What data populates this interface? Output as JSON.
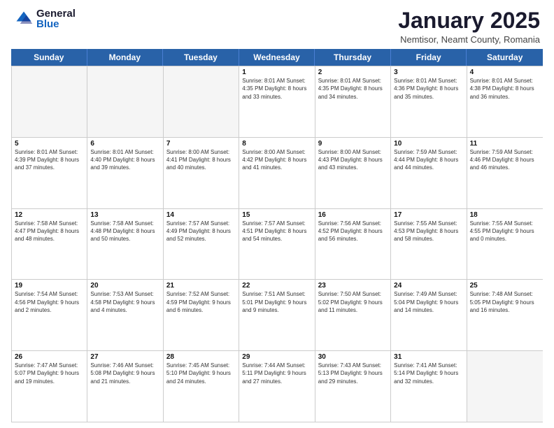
{
  "header": {
    "logo_general": "General",
    "logo_blue": "Blue",
    "month_title": "January 2025",
    "subtitle": "Nemtisor, Neamt County, Romania"
  },
  "day_headers": [
    "Sunday",
    "Monday",
    "Tuesday",
    "Wednesday",
    "Thursday",
    "Friday",
    "Saturday"
  ],
  "weeks": [
    [
      {
        "number": "",
        "info": ""
      },
      {
        "number": "",
        "info": ""
      },
      {
        "number": "",
        "info": ""
      },
      {
        "number": "1",
        "info": "Sunrise: 8:01 AM\nSunset: 4:35 PM\nDaylight: 8 hours and 33 minutes."
      },
      {
        "number": "2",
        "info": "Sunrise: 8:01 AM\nSunset: 4:35 PM\nDaylight: 8 hours and 34 minutes."
      },
      {
        "number": "3",
        "info": "Sunrise: 8:01 AM\nSunset: 4:36 PM\nDaylight: 8 hours and 35 minutes."
      },
      {
        "number": "4",
        "info": "Sunrise: 8:01 AM\nSunset: 4:38 PM\nDaylight: 8 hours and 36 minutes."
      }
    ],
    [
      {
        "number": "5",
        "info": "Sunrise: 8:01 AM\nSunset: 4:39 PM\nDaylight: 8 hours and 37 minutes."
      },
      {
        "number": "6",
        "info": "Sunrise: 8:01 AM\nSunset: 4:40 PM\nDaylight: 8 hours and 39 minutes."
      },
      {
        "number": "7",
        "info": "Sunrise: 8:00 AM\nSunset: 4:41 PM\nDaylight: 8 hours and 40 minutes."
      },
      {
        "number": "8",
        "info": "Sunrise: 8:00 AM\nSunset: 4:42 PM\nDaylight: 8 hours and 41 minutes."
      },
      {
        "number": "9",
        "info": "Sunrise: 8:00 AM\nSunset: 4:43 PM\nDaylight: 8 hours and 43 minutes."
      },
      {
        "number": "10",
        "info": "Sunrise: 7:59 AM\nSunset: 4:44 PM\nDaylight: 8 hours and 44 minutes."
      },
      {
        "number": "11",
        "info": "Sunrise: 7:59 AM\nSunset: 4:46 PM\nDaylight: 8 hours and 46 minutes."
      }
    ],
    [
      {
        "number": "12",
        "info": "Sunrise: 7:58 AM\nSunset: 4:47 PM\nDaylight: 8 hours and 48 minutes."
      },
      {
        "number": "13",
        "info": "Sunrise: 7:58 AM\nSunset: 4:48 PM\nDaylight: 8 hours and 50 minutes."
      },
      {
        "number": "14",
        "info": "Sunrise: 7:57 AM\nSunset: 4:49 PM\nDaylight: 8 hours and 52 minutes."
      },
      {
        "number": "15",
        "info": "Sunrise: 7:57 AM\nSunset: 4:51 PM\nDaylight: 8 hours and 54 minutes."
      },
      {
        "number": "16",
        "info": "Sunrise: 7:56 AM\nSunset: 4:52 PM\nDaylight: 8 hours and 56 minutes."
      },
      {
        "number": "17",
        "info": "Sunrise: 7:55 AM\nSunset: 4:53 PM\nDaylight: 8 hours and 58 minutes."
      },
      {
        "number": "18",
        "info": "Sunrise: 7:55 AM\nSunset: 4:55 PM\nDaylight: 9 hours and 0 minutes."
      }
    ],
    [
      {
        "number": "19",
        "info": "Sunrise: 7:54 AM\nSunset: 4:56 PM\nDaylight: 9 hours and 2 minutes."
      },
      {
        "number": "20",
        "info": "Sunrise: 7:53 AM\nSunset: 4:58 PM\nDaylight: 9 hours and 4 minutes."
      },
      {
        "number": "21",
        "info": "Sunrise: 7:52 AM\nSunset: 4:59 PM\nDaylight: 9 hours and 6 minutes."
      },
      {
        "number": "22",
        "info": "Sunrise: 7:51 AM\nSunset: 5:01 PM\nDaylight: 9 hours and 9 minutes."
      },
      {
        "number": "23",
        "info": "Sunrise: 7:50 AM\nSunset: 5:02 PM\nDaylight: 9 hours and 11 minutes."
      },
      {
        "number": "24",
        "info": "Sunrise: 7:49 AM\nSunset: 5:04 PM\nDaylight: 9 hours and 14 minutes."
      },
      {
        "number": "25",
        "info": "Sunrise: 7:48 AM\nSunset: 5:05 PM\nDaylight: 9 hours and 16 minutes."
      }
    ],
    [
      {
        "number": "26",
        "info": "Sunrise: 7:47 AM\nSunset: 5:07 PM\nDaylight: 9 hours and 19 minutes."
      },
      {
        "number": "27",
        "info": "Sunrise: 7:46 AM\nSunset: 5:08 PM\nDaylight: 9 hours and 21 minutes."
      },
      {
        "number": "28",
        "info": "Sunrise: 7:45 AM\nSunset: 5:10 PM\nDaylight: 9 hours and 24 minutes."
      },
      {
        "number": "29",
        "info": "Sunrise: 7:44 AM\nSunset: 5:11 PM\nDaylight: 9 hours and 27 minutes."
      },
      {
        "number": "30",
        "info": "Sunrise: 7:43 AM\nSunset: 5:13 PM\nDaylight: 9 hours and 29 minutes."
      },
      {
        "number": "31",
        "info": "Sunrise: 7:41 AM\nSunset: 5:14 PM\nDaylight: 9 hours and 32 minutes."
      },
      {
        "number": "",
        "info": ""
      }
    ]
  ]
}
